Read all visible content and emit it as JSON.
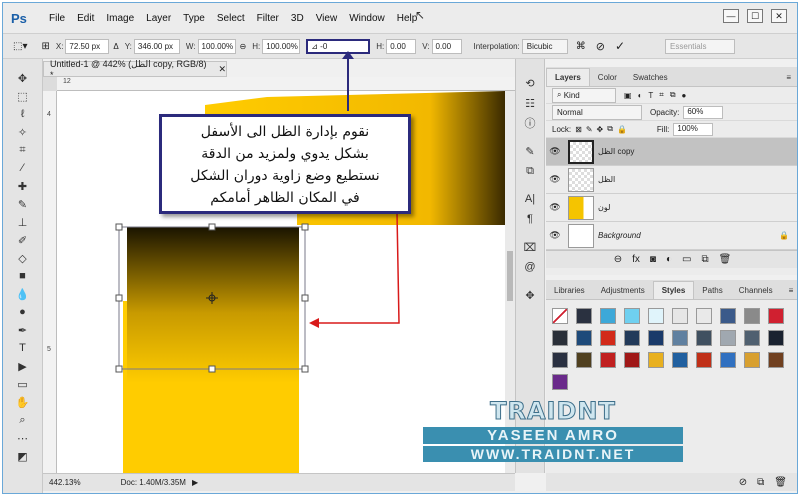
{
  "app": {
    "logo": "Ps"
  },
  "menu": [
    "File",
    "Edit",
    "Image",
    "Layer",
    "Type",
    "Select",
    "Filter",
    "3D",
    "View",
    "Window",
    "Help"
  ],
  "window_controls": {
    "minimize": "—",
    "maximize": "☐",
    "close": "✕"
  },
  "options": {
    "x_label": "X:",
    "x_value": "72.50 px",
    "y_label": "Y:",
    "y_value": "346.00 px",
    "w_label": "W:",
    "w_value": "100.00%",
    "h_label": "H:",
    "h_value": "100.00%",
    "rot_value": "-0",
    "hskew_label": "H:",
    "hskew_value": "0.00",
    "vskew_label": "V:",
    "vskew_value": "0.00",
    "interp_label": "Interpolation:",
    "interp_value": "Bicubic",
    "workspace": "Essentials"
  },
  "document": {
    "tab_title": "Untitled-1 @ 442% (الظل copy, RGB/8) *",
    "ruler_top_label": "12",
    "ruler_left_labels": [
      "4",
      "5"
    ],
    "zoom": "442.13%",
    "doc_info": "Doc: 1.40M/3.35M"
  },
  "annotation": {
    "line1": "نقوم بإدارة الظل الى الأسفل",
    "line2": "بشكل يدوي ولمزيد من الدقة",
    "line3": "نستطيع وضع زاوية دوران الشكل",
    "line4": "في المكان الظاهر أمامكم"
  },
  "layers_panel": {
    "tabs": [
      "Layers",
      "Color",
      "Swatches"
    ],
    "active_tab": "Layers",
    "kind": "Kind",
    "blend_mode": "Normal",
    "opacity_label": "Opacity:",
    "opacity_value": "60%",
    "lock_label": "Lock:",
    "fill_label": "Fill:",
    "fill_value": "100%",
    "layers": [
      {
        "name": "الظل copy",
        "selected": true
      },
      {
        "name": "الظل",
        "selected": false
      },
      {
        "name": "لون",
        "selected": false
      },
      {
        "name": "Background",
        "selected": false
      }
    ]
  },
  "styles_panel": {
    "tabs": [
      "Libraries",
      "Adjustments",
      "Styles",
      "Paths",
      "Channels"
    ],
    "active_tab": "Styles",
    "swatch_colors": [
      "#ffffff",
      "#2a3140",
      "#3da8d8",
      "#6fd0f0",
      "#e0f4fb",
      "#e6e6e6",
      "#e9e9e9",
      "#3b5a8a",
      "#8a8a8a",
      "#d02030",
      "#2a2f38",
      "#1e4a7a",
      "#d22a1a",
      "#223a5a",
      "#1a3a6a",
      "#6080a0",
      "#405060",
      "#a0a8b0",
      "#506070",
      "#1a2230",
      "#2a3040",
      "#504020",
      "#c02020",
      "#a01818",
      "#e8b020",
      "#2060a0",
      "#c03018",
      "#3070c0",
      "#d8a030",
      "#704020",
      "#6a2a8a"
    ]
  },
  "watermark": {
    "line1": "TRAIDNT",
    "line2": "YASEEN AMRO",
    "line3": "WWW.TRAIDNT.NET"
  }
}
